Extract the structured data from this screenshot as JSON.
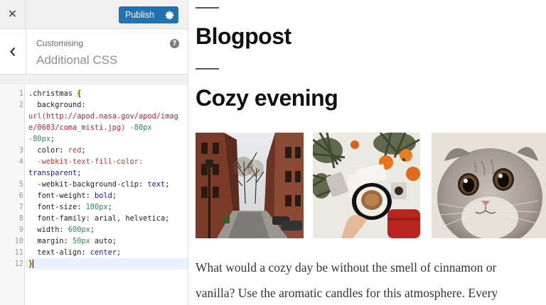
{
  "topbar": {
    "close_glyph": "✕",
    "publish_label": "Publish",
    "publish_settings_icon": "gear-icon",
    "brand_color": "#2271b1"
  },
  "section": {
    "breadcrumb": "Customising",
    "title": "Additional CSS",
    "help_glyph": "?"
  },
  "editor": {
    "line_numbers": [
      "1",
      "2",
      "3",
      "4",
      "5",
      "6",
      "7",
      "8",
      "9",
      "10",
      "11",
      "12"
    ],
    "rows": [
      {
        "num": "1",
        "parts": [
          {
            "t": ".christmas ",
            "c": "tok-sel"
          },
          {
            "t": "{",
            "c": "tok-brace"
          }
        ]
      },
      {
        "num": "2",
        "parts": [
          {
            "t": "  background:",
            "c": "tok-prop"
          }
        ]
      },
      {
        "num": "",
        "parts": [
          {
            "t": "url(",
            "c": "tok-kwr"
          },
          {
            "t": "http://apod.nasa.gov/apod/imag",
            "c": "tok-url"
          }
        ]
      },
      {
        "num": "",
        "parts": [
          {
            "t": "e/0603/coma_misti.jpg",
            "c": "tok-url"
          },
          {
            "t": ") ",
            "c": "tok-kwr"
          },
          {
            "t": "-80px",
            "c": "tok-num"
          }
        ]
      },
      {
        "num": "",
        "parts": [
          {
            "t": "-80px",
            "c": "tok-num"
          },
          {
            "t": ";",
            "c": "tok-prop"
          }
        ]
      },
      {
        "num": "3",
        "parts": [
          {
            "t": "  color: ",
            "c": "tok-prop"
          },
          {
            "t": "red",
            "c": "tok-kwr"
          },
          {
            "t": ";",
            "c": "tok-prop"
          }
        ]
      },
      {
        "num": "4",
        "parts": [
          {
            "t": "  -webkit-text-fill-color:",
            "c": "tok-vend"
          }
        ]
      },
      {
        "num": "",
        "parts": [
          {
            "t": "transparent",
            "c": "tok-kw"
          },
          {
            "t": ";",
            "c": "tok-prop"
          }
        ]
      },
      {
        "num": "5",
        "parts": [
          {
            "t": "  -webkit-background-clip: ",
            "c": "tok-prop"
          },
          {
            "t": "text",
            "c": "tok-kw"
          },
          {
            "t": ";",
            "c": "tok-prop"
          }
        ]
      },
      {
        "num": "6",
        "parts": [
          {
            "t": "  font-weight: ",
            "c": "tok-prop"
          },
          {
            "t": "bold",
            "c": "tok-kw"
          },
          {
            "t": ";",
            "c": "tok-prop"
          }
        ]
      },
      {
        "num": "7",
        "parts": [
          {
            "t": "  font-size: ",
            "c": "tok-prop"
          },
          {
            "t": "100px",
            "c": "tok-num"
          },
          {
            "t": ";",
            "c": "tok-prop"
          }
        ]
      },
      {
        "num": "8",
        "parts": [
          {
            "t": "  font-family: arial, helvetica;",
            "c": "tok-prop"
          }
        ]
      },
      {
        "num": "9",
        "parts": [
          {
            "t": "  width: ",
            "c": "tok-prop"
          },
          {
            "t": "600px",
            "c": "tok-num"
          },
          {
            "t": ";",
            "c": "tok-prop"
          }
        ]
      },
      {
        "num": "10",
        "parts": [
          {
            "t": "  margin: ",
            "c": "tok-prop"
          },
          {
            "t": "50px",
            "c": "tok-num"
          },
          {
            "t": " auto;",
            "c": "tok-prop"
          }
        ]
      },
      {
        "num": "11",
        "parts": [
          {
            "t": "  text-align: ",
            "c": "tok-prop"
          },
          {
            "t": "center",
            "c": "tok-kw"
          },
          {
            "t": ";",
            "c": "tok-prop"
          }
        ]
      },
      {
        "num": "12",
        "parts": [
          {
            "t": "}",
            "c": "tok-brace"
          }
        ],
        "active": true
      }
    ]
  },
  "preview": {
    "page_heading": "Blogpost",
    "post_title": "Cozy evening",
    "images": [
      {
        "name": "street-photo"
      },
      {
        "name": "coffee-photo"
      },
      {
        "name": "kitten-photo"
      }
    ],
    "body_text": "What would a cozy day be without the smell of cinnamon or vanilla? Use the aromatic candles for this atmosphere. Every"
  }
}
